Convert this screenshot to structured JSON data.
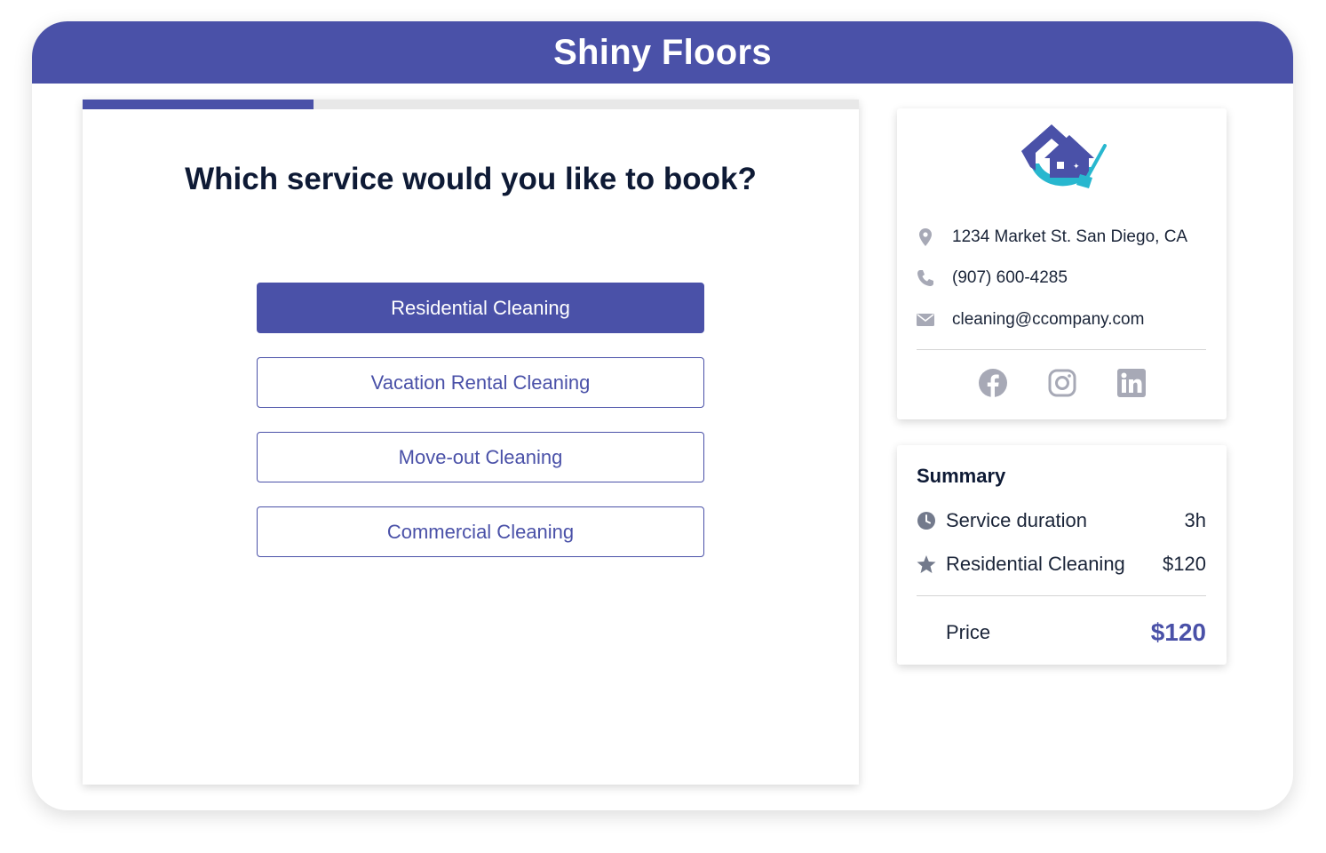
{
  "header": {
    "title": "Shiny Floors"
  },
  "progress": {
    "fraction": 0.298
  },
  "question": {
    "text": "Which service would you like to book?"
  },
  "options": [
    {
      "label": "Residential Cleaning",
      "selected": true
    },
    {
      "label": "Vacation Rental Cleaning",
      "selected": false
    },
    {
      "label": "Move-out Cleaning",
      "selected": false
    },
    {
      "label": "Commercial Cleaning",
      "selected": false
    }
  ],
  "contact": {
    "address": "1234 Market St. San Diego, CA",
    "phone": "(907) 600-4285",
    "email": "cleaning@ccompany.com",
    "icons": [
      "map-pin-icon",
      "phone-icon",
      "envelope-icon"
    ],
    "socials": [
      "facebook-icon",
      "instagram-icon",
      "linkedin-icon"
    ]
  },
  "summary": {
    "title": "Summary",
    "rows": [
      {
        "icon": "clock-icon",
        "label": "Service duration",
        "value": "3h"
      },
      {
        "icon": "star-icon",
        "label": "Residential Cleaning",
        "value": "$120"
      }
    ],
    "price_label": "Price",
    "price_value": "$120"
  },
  "colors": {
    "brand": "#4a51a8",
    "text_dark": "#0e1a35",
    "icon_gray": "#a7a9b6",
    "logo_teal": "#28b7cf"
  }
}
